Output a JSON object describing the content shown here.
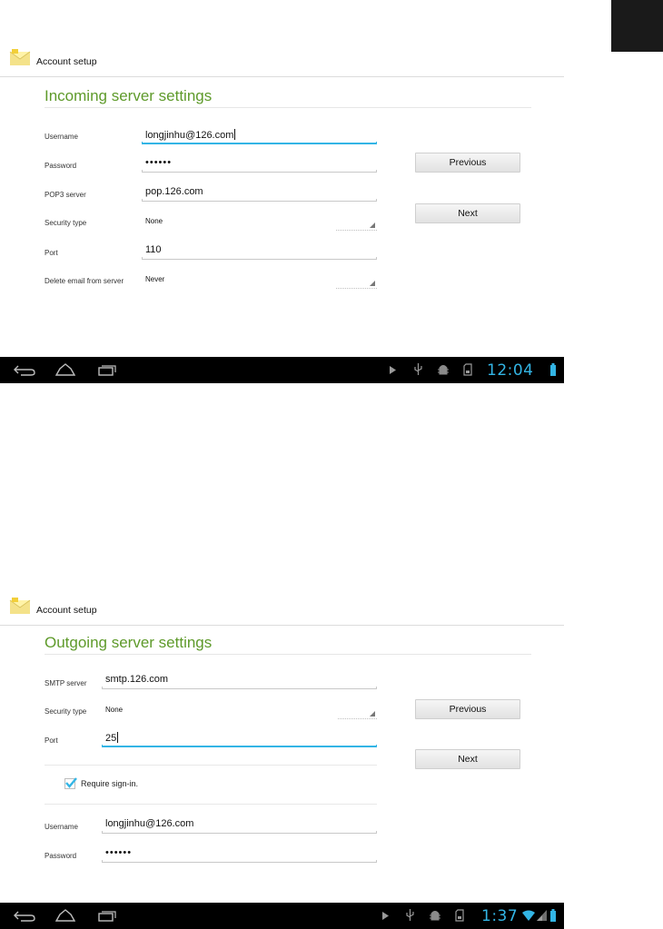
{
  "incoming": {
    "app_title": "Account setup",
    "section_title": "Incoming server settings",
    "fields": {
      "username": {
        "label": "Username",
        "value": "longjinhu@126.com"
      },
      "password": {
        "label": "Password",
        "value": "••••••"
      },
      "pop3": {
        "label": "POP3 server",
        "value": "pop.126.com"
      },
      "security": {
        "label": "Security type",
        "value": "None"
      },
      "port": {
        "label": "Port",
        "value": "110"
      },
      "delete": {
        "label": "Delete email from server",
        "value": "Never"
      }
    },
    "buttons": {
      "previous": "Previous",
      "next": "Next"
    },
    "status": {
      "clock": "12:04"
    }
  },
  "outgoing": {
    "app_title": "Account setup",
    "section_title": "Outgoing server settings",
    "fields": {
      "smtp": {
        "label": "SMTP server",
        "value": "smtp.126.com"
      },
      "security": {
        "label": "Security type",
        "value": "None"
      },
      "port": {
        "label": "Port",
        "value": "25"
      },
      "username": {
        "label": "Username",
        "value": "longjinhu@126.com"
      },
      "password": {
        "label": "Password",
        "value": "••••••"
      }
    },
    "require_signin": {
      "label": "Require sign-in.",
      "checked": true
    },
    "buttons": {
      "previous": "Previous",
      "next": "Next"
    },
    "status": {
      "clock": "1:37"
    }
  },
  "colors": {
    "accent_green": "#5e9a2a",
    "holo_blue": "#33b5e5",
    "navbar": "#000000"
  },
  "icons": [
    "email-app-icon",
    "back-icon",
    "home-icon",
    "recent-apps-icon",
    "play-icon",
    "usb-icon",
    "debug-icon",
    "sd-card-icon",
    "battery-icon",
    "wifi-icon",
    "signal-icon",
    "dropdown-triangle-icon",
    "checkmark-icon"
  ]
}
